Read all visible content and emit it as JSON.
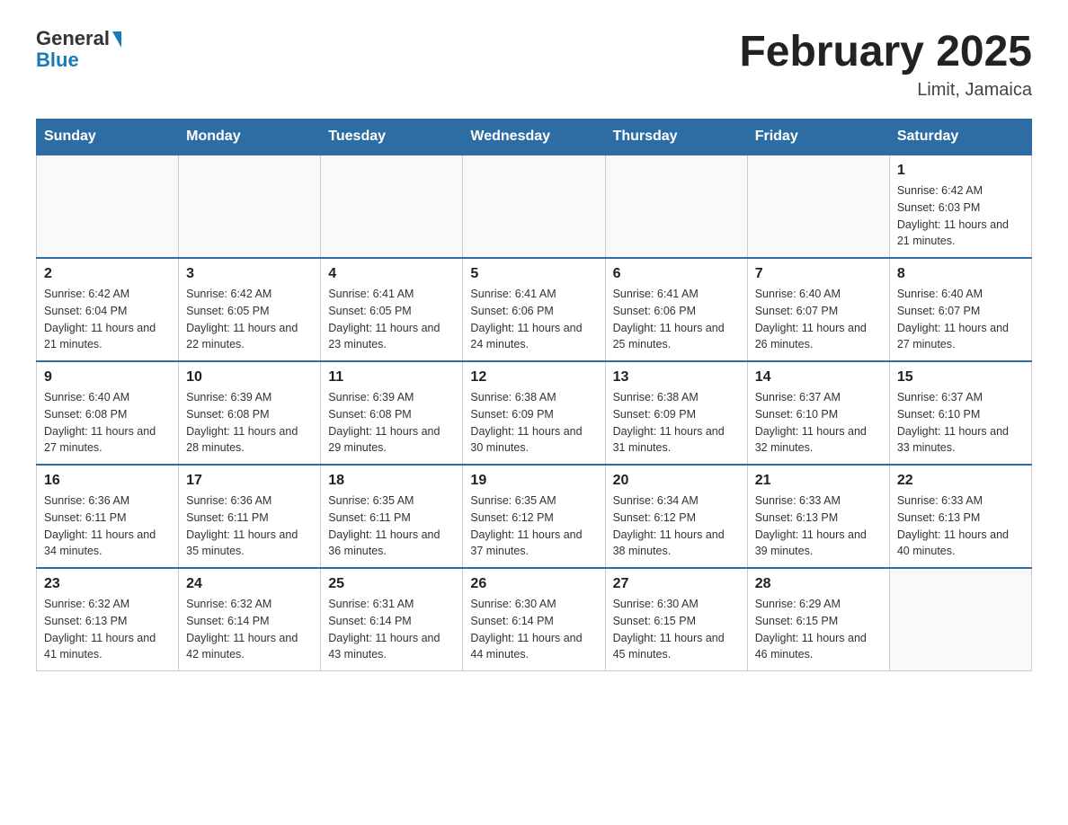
{
  "header": {
    "logo_general": "General",
    "logo_blue": "Blue",
    "title": "February 2025",
    "subtitle": "Limit, Jamaica"
  },
  "weekdays": [
    "Sunday",
    "Monday",
    "Tuesday",
    "Wednesday",
    "Thursday",
    "Friday",
    "Saturday"
  ],
  "weeks": [
    [
      {
        "day": "",
        "info": ""
      },
      {
        "day": "",
        "info": ""
      },
      {
        "day": "",
        "info": ""
      },
      {
        "day": "",
        "info": ""
      },
      {
        "day": "",
        "info": ""
      },
      {
        "day": "",
        "info": ""
      },
      {
        "day": "1",
        "info": "Sunrise: 6:42 AM\nSunset: 6:03 PM\nDaylight: 11 hours and 21 minutes."
      }
    ],
    [
      {
        "day": "2",
        "info": "Sunrise: 6:42 AM\nSunset: 6:04 PM\nDaylight: 11 hours and 21 minutes."
      },
      {
        "day": "3",
        "info": "Sunrise: 6:42 AM\nSunset: 6:05 PM\nDaylight: 11 hours and 22 minutes."
      },
      {
        "day": "4",
        "info": "Sunrise: 6:41 AM\nSunset: 6:05 PM\nDaylight: 11 hours and 23 minutes."
      },
      {
        "day": "5",
        "info": "Sunrise: 6:41 AM\nSunset: 6:06 PM\nDaylight: 11 hours and 24 minutes."
      },
      {
        "day": "6",
        "info": "Sunrise: 6:41 AM\nSunset: 6:06 PM\nDaylight: 11 hours and 25 minutes."
      },
      {
        "day": "7",
        "info": "Sunrise: 6:40 AM\nSunset: 6:07 PM\nDaylight: 11 hours and 26 minutes."
      },
      {
        "day": "8",
        "info": "Sunrise: 6:40 AM\nSunset: 6:07 PM\nDaylight: 11 hours and 27 minutes."
      }
    ],
    [
      {
        "day": "9",
        "info": "Sunrise: 6:40 AM\nSunset: 6:08 PM\nDaylight: 11 hours and 27 minutes."
      },
      {
        "day": "10",
        "info": "Sunrise: 6:39 AM\nSunset: 6:08 PM\nDaylight: 11 hours and 28 minutes."
      },
      {
        "day": "11",
        "info": "Sunrise: 6:39 AM\nSunset: 6:08 PM\nDaylight: 11 hours and 29 minutes."
      },
      {
        "day": "12",
        "info": "Sunrise: 6:38 AM\nSunset: 6:09 PM\nDaylight: 11 hours and 30 minutes."
      },
      {
        "day": "13",
        "info": "Sunrise: 6:38 AM\nSunset: 6:09 PM\nDaylight: 11 hours and 31 minutes."
      },
      {
        "day": "14",
        "info": "Sunrise: 6:37 AM\nSunset: 6:10 PM\nDaylight: 11 hours and 32 minutes."
      },
      {
        "day": "15",
        "info": "Sunrise: 6:37 AM\nSunset: 6:10 PM\nDaylight: 11 hours and 33 minutes."
      }
    ],
    [
      {
        "day": "16",
        "info": "Sunrise: 6:36 AM\nSunset: 6:11 PM\nDaylight: 11 hours and 34 minutes."
      },
      {
        "day": "17",
        "info": "Sunrise: 6:36 AM\nSunset: 6:11 PM\nDaylight: 11 hours and 35 minutes."
      },
      {
        "day": "18",
        "info": "Sunrise: 6:35 AM\nSunset: 6:11 PM\nDaylight: 11 hours and 36 minutes."
      },
      {
        "day": "19",
        "info": "Sunrise: 6:35 AM\nSunset: 6:12 PM\nDaylight: 11 hours and 37 minutes."
      },
      {
        "day": "20",
        "info": "Sunrise: 6:34 AM\nSunset: 6:12 PM\nDaylight: 11 hours and 38 minutes."
      },
      {
        "day": "21",
        "info": "Sunrise: 6:33 AM\nSunset: 6:13 PM\nDaylight: 11 hours and 39 minutes."
      },
      {
        "day": "22",
        "info": "Sunrise: 6:33 AM\nSunset: 6:13 PM\nDaylight: 11 hours and 40 minutes."
      }
    ],
    [
      {
        "day": "23",
        "info": "Sunrise: 6:32 AM\nSunset: 6:13 PM\nDaylight: 11 hours and 41 minutes."
      },
      {
        "day": "24",
        "info": "Sunrise: 6:32 AM\nSunset: 6:14 PM\nDaylight: 11 hours and 42 minutes."
      },
      {
        "day": "25",
        "info": "Sunrise: 6:31 AM\nSunset: 6:14 PM\nDaylight: 11 hours and 43 minutes."
      },
      {
        "day": "26",
        "info": "Sunrise: 6:30 AM\nSunset: 6:14 PM\nDaylight: 11 hours and 44 minutes."
      },
      {
        "day": "27",
        "info": "Sunrise: 6:30 AM\nSunset: 6:15 PM\nDaylight: 11 hours and 45 minutes."
      },
      {
        "day": "28",
        "info": "Sunrise: 6:29 AM\nSunset: 6:15 PM\nDaylight: 11 hours and 46 minutes."
      },
      {
        "day": "",
        "info": ""
      }
    ]
  ]
}
